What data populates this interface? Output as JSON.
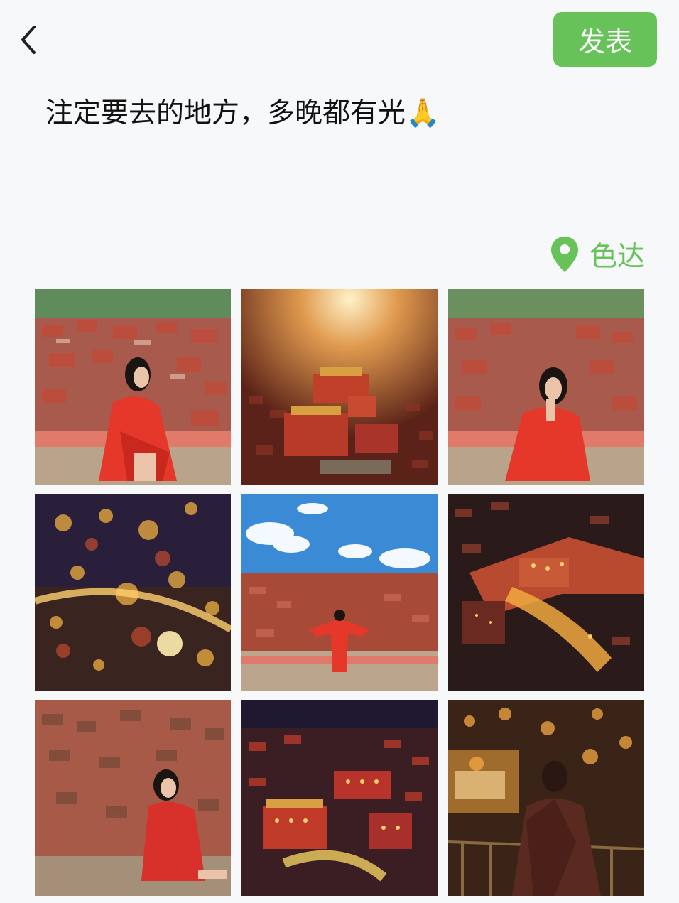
{
  "header": {
    "back_icon": "chevron-left-icon",
    "publish_label": "发表"
  },
  "post": {
    "text": "注定要去的地方，多晚都有光🙏"
  },
  "location": {
    "icon": "location-pin-icon",
    "label": "色达"
  },
  "photos": [
    {
      "scene": "woman in red coat sitting on hillside with red houses",
      "palette": [
        "#b55a4a",
        "#e5382a",
        "#5f8c5a"
      ]
    },
    {
      "scene": "aerial view of monastery with sunlight rays",
      "palette": [
        "#6b2a1e",
        "#d27a3a",
        "#f3c47a"
      ]
    },
    {
      "scene": "woman in red coat resting chin on hand with red houses",
      "palette": [
        "#b55a4a",
        "#e5382a",
        "#6b8f5e"
      ]
    },
    {
      "scene": "night city lights bokeh",
      "palette": [
        "#2a1f3a",
        "#f0b040",
        "#c24a30"
      ]
    },
    {
      "scene": "woman in red with arms outstretched under blue sky",
      "palette": [
        "#3b8ad6",
        "#a84a38",
        "#e5382a"
      ]
    },
    {
      "scene": "night aerial view of valley with lit monastery",
      "palette": [
        "#2a1a1a",
        "#e08a3a",
        "#8a3a2a"
      ]
    },
    {
      "scene": "woman in red sitting in front of red houses",
      "palette": [
        "#a85a48",
        "#d8302a",
        "#7b6a5a"
      ]
    },
    {
      "scene": "night view of monastery buildings lit up",
      "palette": [
        "#1e1830",
        "#f0a040",
        "#b83a2a"
      ]
    },
    {
      "scene": "monk looking at night lights",
      "palette": [
        "#3a2418",
        "#f4a842",
        "#5a2a20"
      ]
    }
  ]
}
